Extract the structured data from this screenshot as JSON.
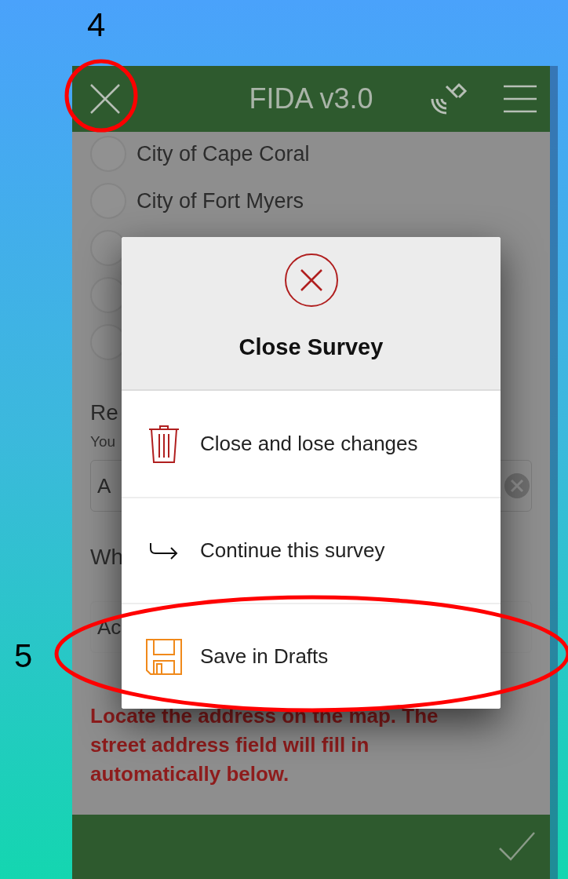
{
  "annotations": [
    {
      "label": "4"
    },
    {
      "label": "5"
    }
  ],
  "header": {
    "title": "FIDA v3.0"
  },
  "form": {
    "radio_options": [
      {
        "label": "City of Cape Coral",
        "selected": false
      },
      {
        "label": "City of Fort Myers",
        "selected": false
      },
      {
        "selected": false
      },
      {
        "selected": false
      },
      {
        "selected": false
      }
    ],
    "region_label": "Re",
    "region_hint": "You",
    "region_field": {
      "value": "A"
    },
    "question_label": "Wh",
    "question_field": {
      "value": "Ac"
    },
    "instruction": "Locate the address on the map. The street address field will fill in automatically below."
  },
  "dialog": {
    "title": "Close Survey",
    "options": [
      {
        "kind": "discard",
        "label": "Close and lose changes"
      },
      {
        "kind": "continue",
        "label": "Continue this survey"
      },
      {
        "kind": "save",
        "label": "Save in Drafts"
      }
    ]
  }
}
